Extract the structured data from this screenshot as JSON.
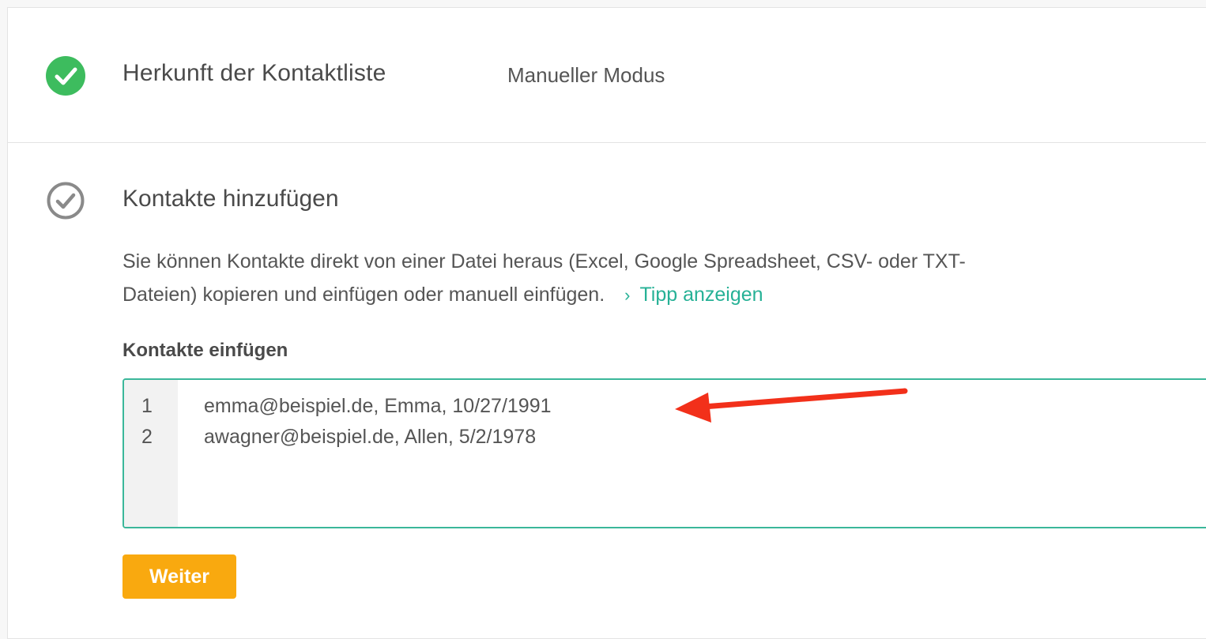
{
  "step1": {
    "title": "Herkunft der Kontaktliste",
    "value": "Manueller Modus",
    "status_icon": "check-circle-filled-icon",
    "status_color": "#3dbc5e"
  },
  "step2": {
    "title": "Kontakte hinzufügen",
    "status_icon": "check-circle-outline-icon",
    "description": "Sie können Kontakte direkt von einer Datei heraus (Excel, Google Spreadsheet, CSV- oder TXT-Dateien) kopieren und einfügen oder manuell einfügen.",
    "tip_link": "Tipp anzeigen",
    "field_label": "Kontakte einfügen",
    "lines": [
      {
        "number": "1",
        "text": "emma@beispiel.de, Emma, 10/27/1991"
      },
      {
        "number": "2",
        "text": "awagner@beispiel.de, Allen, 5/2/1978"
      }
    ],
    "annotation_arrow_color": "#f2301a"
  },
  "actions": {
    "next_label": "Weiter",
    "next_color": "#f9a90f"
  },
  "colors": {
    "accent": "#26b196",
    "editor_border": "#3bb79a"
  }
}
